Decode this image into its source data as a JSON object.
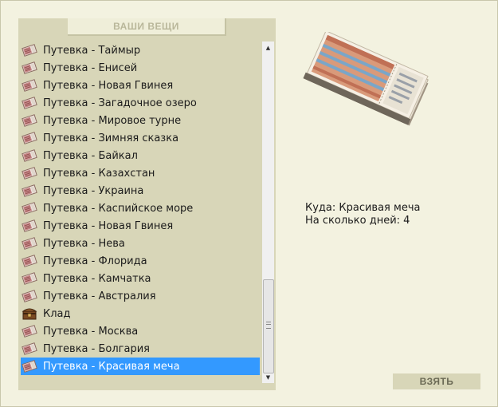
{
  "panel": {
    "title": "ВАШИ ВЕЩИ"
  },
  "items": [
    {
      "label": "Путевка - Таймыр",
      "icon": "ticket-icon"
    },
    {
      "label": "Путевка - Енисей",
      "icon": "ticket-icon"
    },
    {
      "label": "Путевка - Новая Гвинея",
      "icon": "ticket-icon"
    },
    {
      "label": "Путевка - Загадочное озеро",
      "icon": "ticket-icon"
    },
    {
      "label": "Путевка - Мировое турне",
      "icon": "ticket-icon"
    },
    {
      "label": "Путевка - Зимняя сказка",
      "icon": "ticket-icon"
    },
    {
      "label": "Путевка - Байкал",
      "icon": "ticket-icon"
    },
    {
      "label": "Путевка - Казахстан",
      "icon": "ticket-icon"
    },
    {
      "label": "Путевка - Украина",
      "icon": "ticket-icon"
    },
    {
      "label": "Путевка - Каспийское море",
      "icon": "ticket-icon"
    },
    {
      "label": "Путевка - Новая Гвинея",
      "icon": "ticket-icon"
    },
    {
      "label": "Путевка - Нева",
      "icon": "ticket-icon"
    },
    {
      "label": "Путевка - Флорида",
      "icon": "ticket-icon"
    },
    {
      "label": "Путевка - Камчатка",
      "icon": "ticket-icon"
    },
    {
      "label": "Путевка - Австралия",
      "icon": "ticket-icon"
    },
    {
      "label": "Клад",
      "icon": "treasure-chest-icon"
    },
    {
      "label": "Путевка - Москва",
      "icon": "ticket-icon"
    },
    {
      "label": "Путевка - Болгария",
      "icon": "ticket-icon"
    },
    {
      "label": "Путевка - Красивая меча",
      "icon": "ticket-icon",
      "selected": true
    }
  ],
  "details": {
    "destination": "Куда: Красивая меча",
    "days": "На сколько дней: 4"
  },
  "take_button": {
    "label": "ВЗЯТЬ"
  },
  "colors": {
    "background": "#f3f2e0",
    "panel": "#d8d6b8",
    "selection": "#3399ff"
  }
}
